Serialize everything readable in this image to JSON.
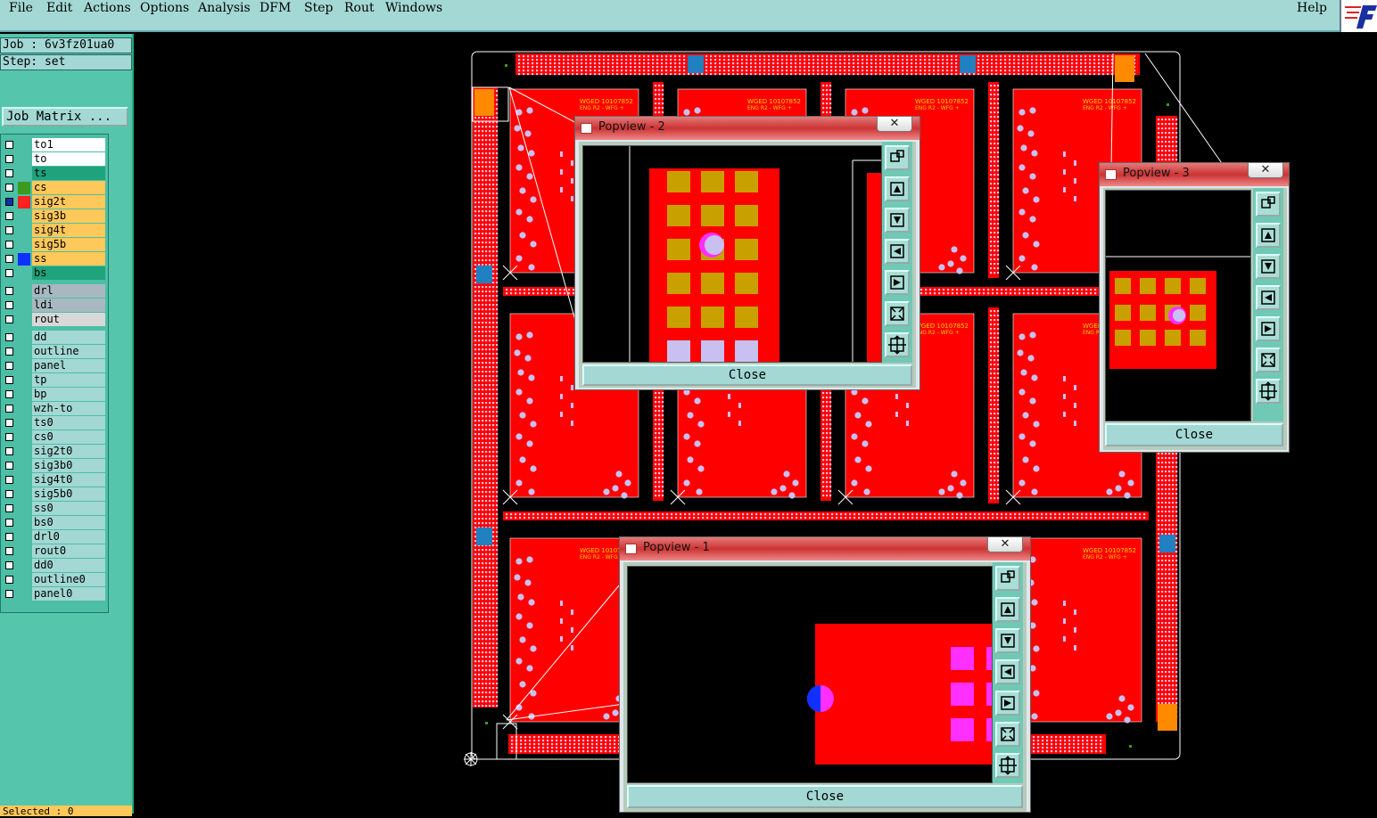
{
  "menu": {
    "items": [
      "File",
      "Edit",
      "Actions",
      "Options",
      "Analysis",
      "DFM",
      "Step",
      "Rout",
      "Windows"
    ],
    "help": "Help"
  },
  "job": {
    "label": "Job : 6v3fz01ua0"
  },
  "step": {
    "label": "Step: set"
  },
  "job_matrix": {
    "label": "Job Matrix ..."
  },
  "layers": [
    {
      "name": "to1",
      "color": "#ffffff",
      "swatch": ""
    },
    {
      "name": "to",
      "color": "#ffffff",
      "swatch": ""
    },
    {
      "name": "ts",
      "color": "#1fa37c",
      "swatch": ""
    },
    {
      "name": "cs",
      "color": "#ffc85a",
      "swatch": "#3c9a1e"
    },
    {
      "name": "sig2t",
      "color": "#ffc85a",
      "swatch": "#ff2020"
    },
    {
      "name": "sig3b",
      "color": "#ffc85a",
      "swatch": ""
    },
    {
      "name": "sig4t",
      "color": "#ffc85a",
      "swatch": ""
    },
    {
      "name": "sig5b",
      "color": "#ffc85a",
      "swatch": ""
    },
    {
      "name": "ss",
      "color": "#ffc85a",
      "swatch": "#1030ff"
    },
    {
      "name": "bs",
      "color": "#1fa37c",
      "swatch": ""
    },
    {
      "name": "drl",
      "color": "#a8b8c0",
      "swatch": ""
    },
    {
      "name": "ldi",
      "color": "#a8b8c0",
      "swatch": ""
    },
    {
      "name": "rout",
      "color": "#d8d8d8",
      "swatch": ""
    },
    {
      "name": "dd",
      "color": "#a3d8d4",
      "swatch": ""
    },
    {
      "name": "outline",
      "color": "#a3d8d4",
      "swatch": ""
    },
    {
      "name": "panel",
      "color": "#a3d8d4",
      "swatch": ""
    },
    {
      "name": "tp",
      "color": "#a3d8d4",
      "swatch": ""
    },
    {
      "name": "bp",
      "color": "#a3d8d4",
      "swatch": ""
    },
    {
      "name": "wzh-to",
      "color": "#a3d8d4",
      "swatch": ""
    },
    {
      "name": "ts0",
      "color": "#a3d8d4",
      "swatch": ""
    },
    {
      "name": "cs0",
      "color": "#a3d8d4",
      "swatch": ""
    },
    {
      "name": "sig2t0",
      "color": "#a3d8d4",
      "swatch": ""
    },
    {
      "name": "sig3b0",
      "color": "#a3d8d4",
      "swatch": ""
    },
    {
      "name": "sig4t0",
      "color": "#a3d8d4",
      "swatch": ""
    },
    {
      "name": "sig5b0",
      "color": "#a3d8d4",
      "swatch": ""
    },
    {
      "name": "ss0",
      "color": "#a3d8d4",
      "swatch": ""
    },
    {
      "name": "bs0",
      "color": "#a3d8d4",
      "swatch": ""
    },
    {
      "name": "drl0",
      "color": "#a3d8d4",
      "swatch": ""
    },
    {
      "name": "rout0",
      "color": "#a3d8d4",
      "swatch": ""
    },
    {
      "name": "dd0",
      "color": "#a3d8d4",
      "swatch": ""
    },
    {
      "name": "outline0",
      "color": "#a3d8d4",
      "swatch": ""
    },
    {
      "name": "panel0",
      "color": "#a3d8d4",
      "swatch": ""
    }
  ],
  "selected": {
    "label": "Selected : 0"
  },
  "board": {
    "pcb_text_1": "WGED 10107852",
    "pcb_text_2": "ENG R2 - WFG +"
  },
  "popviews": [
    {
      "title": "Popview - 2",
      "close_label": "Close"
    },
    {
      "title": "Popview - 3",
      "close_label": "Close"
    },
    {
      "title": "Popview - 1",
      "close_label": "Close"
    }
  ],
  "colors": {
    "copper": "#ff0000",
    "pad": "#c8a000",
    "via": "#c8c0f0",
    "highlight": "#ff30ff",
    "frame": "#a3d8d4"
  }
}
